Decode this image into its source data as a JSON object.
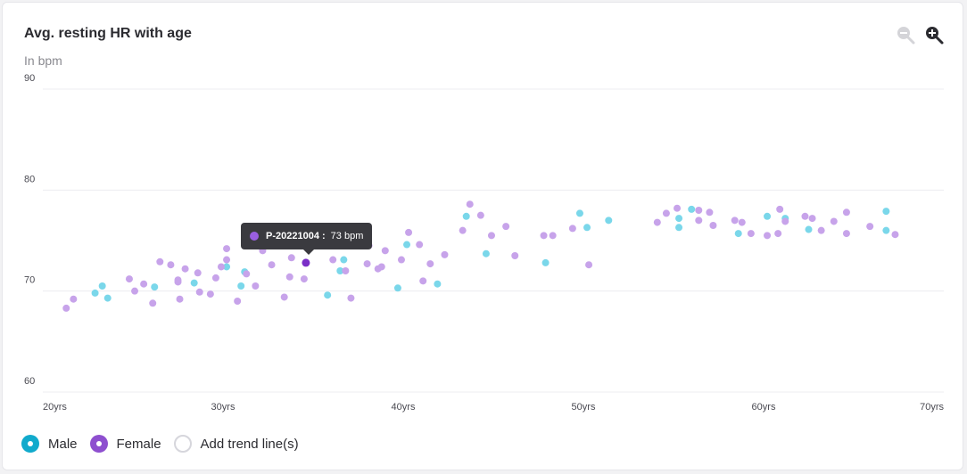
{
  "card": {
    "title": "Avg. resting HR with age",
    "subtitle": "In bpm"
  },
  "toolbar": {
    "zoom_out_icon": "zoom-out-icon",
    "zoom_in_icon": "zoom-in-icon"
  },
  "colors": {
    "male": "#7ad7ea",
    "female": "#c7a3ea",
    "highlight": "#7a2fc7",
    "grid": "#ececf0"
  },
  "legend": {
    "male_label": "Male",
    "female_label": "Female",
    "trend_label": "Add trend line(s)"
  },
  "tooltip": {
    "id": "P-20221004 :",
    "value": "73 bpm"
  },
  "chart_data": {
    "type": "scatter",
    "xlim": [
      20,
      70
    ],
    "ylim": [
      60,
      90
    ],
    "x_ticks": [
      20,
      30,
      40,
      50,
      60,
      70
    ],
    "x_tick_labels": [
      "20yrs",
      "30yrs",
      "40yrs",
      "50yrs",
      "60yrs",
      "70yrs"
    ],
    "y_ticks": [
      90,
      80,
      70,
      60
    ],
    "y_tick_labels": [
      "90",
      "80",
      "70",
      "60"
    ],
    "grid": true,
    "legend_position": "bottom-left",
    "highlight": {
      "series": "Female",
      "x": 34.6,
      "y": 72.8
    },
    "series": [
      {
        "name": "Male",
        "points": [
          [
            22.9,
            69.8
          ],
          [
            23.3,
            70.5
          ],
          [
            23.6,
            69.3
          ],
          [
            26.2,
            70.4
          ],
          [
            28.4,
            70.8
          ],
          [
            30.2,
            72.4
          ],
          [
            31.0,
            70.5
          ],
          [
            31.2,
            71.9
          ],
          [
            35.8,
            69.6
          ],
          [
            36.5,
            72.0
          ],
          [
            36.7,
            73.1
          ],
          [
            39.7,
            70.3
          ],
          [
            40.2,
            74.6
          ],
          [
            41.9,
            70.7
          ],
          [
            43.5,
            77.4
          ],
          [
            44.6,
            73.7
          ],
          [
            47.9,
            72.8
          ],
          [
            49.8,
            77.7
          ],
          [
            50.2,
            76.3
          ],
          [
            51.4,
            77.0
          ],
          [
            55.3,
            77.2
          ],
          [
            55.3,
            76.3
          ],
          [
            56.0,
            78.1
          ],
          [
            58.6,
            75.7
          ],
          [
            60.2,
            77.4
          ],
          [
            61.2,
            77.2
          ],
          [
            62.5,
            76.1
          ],
          [
            66.8,
            77.9
          ],
          [
            66.8,
            76.0
          ]
        ]
      },
      {
        "name": "Female",
        "points": [
          [
            21.3,
            68.3
          ],
          [
            21.7,
            69.2
          ],
          [
            24.8,
            71.2
          ],
          [
            25.1,
            70.0
          ],
          [
            25.6,
            70.7
          ],
          [
            26.1,
            68.8
          ],
          [
            26.5,
            72.9
          ],
          [
            27.1,
            72.6
          ],
          [
            27.5,
            71.1
          ],
          [
            27.5,
            70.9
          ],
          [
            27.6,
            69.2
          ],
          [
            27.9,
            72.2
          ],
          [
            28.6,
            71.8
          ],
          [
            28.7,
            69.9
          ],
          [
            29.3,
            69.7
          ],
          [
            29.6,
            71.3
          ],
          [
            29.9,
            72.4
          ],
          [
            30.2,
            73.1
          ],
          [
            30.2,
            74.2
          ],
          [
            30.8,
            69.0
          ],
          [
            31.3,
            71.7
          ],
          [
            31.8,
            70.5
          ],
          [
            32.2,
            74.0
          ],
          [
            32.7,
            72.6
          ],
          [
            33.4,
            69.4
          ],
          [
            33.7,
            71.4
          ],
          [
            33.8,
            73.3
          ],
          [
            34.5,
            71.2
          ],
          [
            36.1,
            73.1
          ],
          [
            36.8,
            72.0
          ],
          [
            37.1,
            69.3
          ],
          [
            38.0,
            72.7
          ],
          [
            38.1,
            74.5
          ],
          [
            38.6,
            72.2
          ],
          [
            38.8,
            72.4
          ],
          [
            39.0,
            74.0
          ],
          [
            39.9,
            73.1
          ],
          [
            40.3,
            75.8
          ],
          [
            40.9,
            74.6
          ],
          [
            41.1,
            71.0
          ],
          [
            41.5,
            72.7
          ],
          [
            42.3,
            73.6
          ],
          [
            43.3,
            76.0
          ],
          [
            43.7,
            78.6
          ],
          [
            44.3,
            77.5
          ],
          [
            44.9,
            75.5
          ],
          [
            45.7,
            76.4
          ],
          [
            46.2,
            73.5
          ],
          [
            47.8,
            75.5
          ],
          [
            48.3,
            75.5
          ],
          [
            49.4,
            76.2
          ],
          [
            50.3,
            72.6
          ],
          [
            54.1,
            76.8
          ],
          [
            54.6,
            77.7
          ],
          [
            55.2,
            78.2
          ],
          [
            56.4,
            78.0
          ],
          [
            56.4,
            77.0
          ],
          [
            57.0,
            77.8
          ],
          [
            57.2,
            76.5
          ],
          [
            58.4,
            77.0
          ],
          [
            58.8,
            76.8
          ],
          [
            59.3,
            75.7
          ],
          [
            60.2,
            75.5
          ],
          [
            60.8,
            75.7
          ],
          [
            60.9,
            78.1
          ],
          [
            61.2,
            76.9
          ],
          [
            62.3,
            77.4
          ],
          [
            62.7,
            77.2
          ],
          [
            63.2,
            76.0
          ],
          [
            63.9,
            76.9
          ],
          [
            64.6,
            75.7
          ],
          [
            64.6,
            77.8
          ],
          [
            65.9,
            76.4
          ],
          [
            67.3,
            75.6
          ]
        ]
      }
    ]
  }
}
